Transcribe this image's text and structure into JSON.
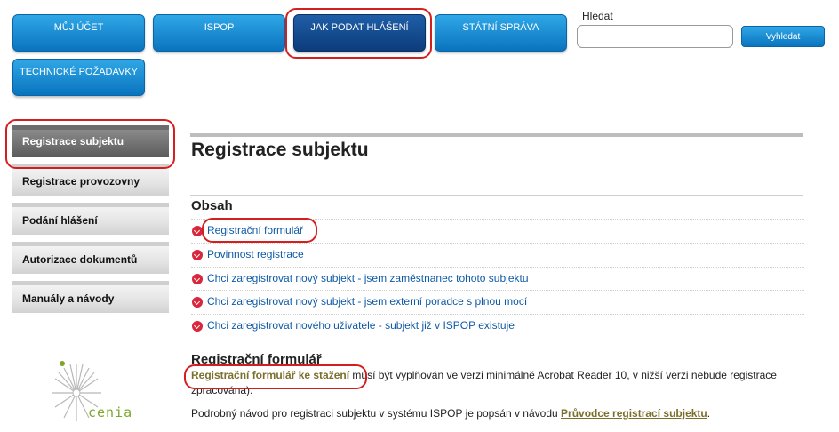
{
  "nav": {
    "items": [
      {
        "label": "MŮJ ÚČET"
      },
      {
        "label": "ISPOP"
      },
      {
        "label": "JAK PODAT HLÁŠENÍ"
      },
      {
        "label": "STÁTNÍ SPRÁVA"
      },
      {
        "label": "TECHNICKÉ POŽADAVKY"
      }
    ],
    "active": "JAK PODAT HLÁŠENÍ"
  },
  "search": {
    "label": "Hledat",
    "value": "",
    "button": "Vyhledat"
  },
  "sidebar": {
    "items": [
      {
        "label": "Registrace subjektu"
      },
      {
        "label": "Registrace provozovny"
      },
      {
        "label": "Podání hlášení"
      },
      {
        "label": "Autorizace dokumentů"
      },
      {
        "label": "Manuály a návody"
      }
    ],
    "active": "Registrace subjektu"
  },
  "logo": {
    "text": "cenia"
  },
  "main": {
    "title": "Registrace subjektu",
    "toc_title": "Obsah",
    "toc": [
      {
        "label": "Registrační formulář"
      },
      {
        "label": "Povinnost registrace"
      },
      {
        "label": "Chci zaregistrovat nový subjekt - jsem zaměstnanec tohoto subjektu"
      },
      {
        "label": "Chci zaregistrovat nový subjekt - jsem externí poradce s plnou mocí"
      },
      {
        "label": "Chci zaregistrovat nového uživatele - subjekt již v ISPOP existuje"
      }
    ],
    "section_title": "Registrační formulář",
    "para1_link": "Registrační formulář ke stažení",
    "para1_text": " musí být vyplňován ve verzi minimálně Acrobat Reader 10, v nižší verzi nebude registrace zpracována).",
    "para2_text": "Podrobný návod pro registraci subjektu v systému ISPOP je popsán v návodu ",
    "para2_link": "Průvodce registrací subjektu",
    "para2_end": "."
  },
  "colors": {
    "nav_blue": "#0a74bf",
    "nav_active": "#0c3c7c",
    "highlight": "#d41f1f",
    "link": "#0e5aa7",
    "doc_link": "#7b6f2c",
    "bullet": "#d9263c"
  }
}
